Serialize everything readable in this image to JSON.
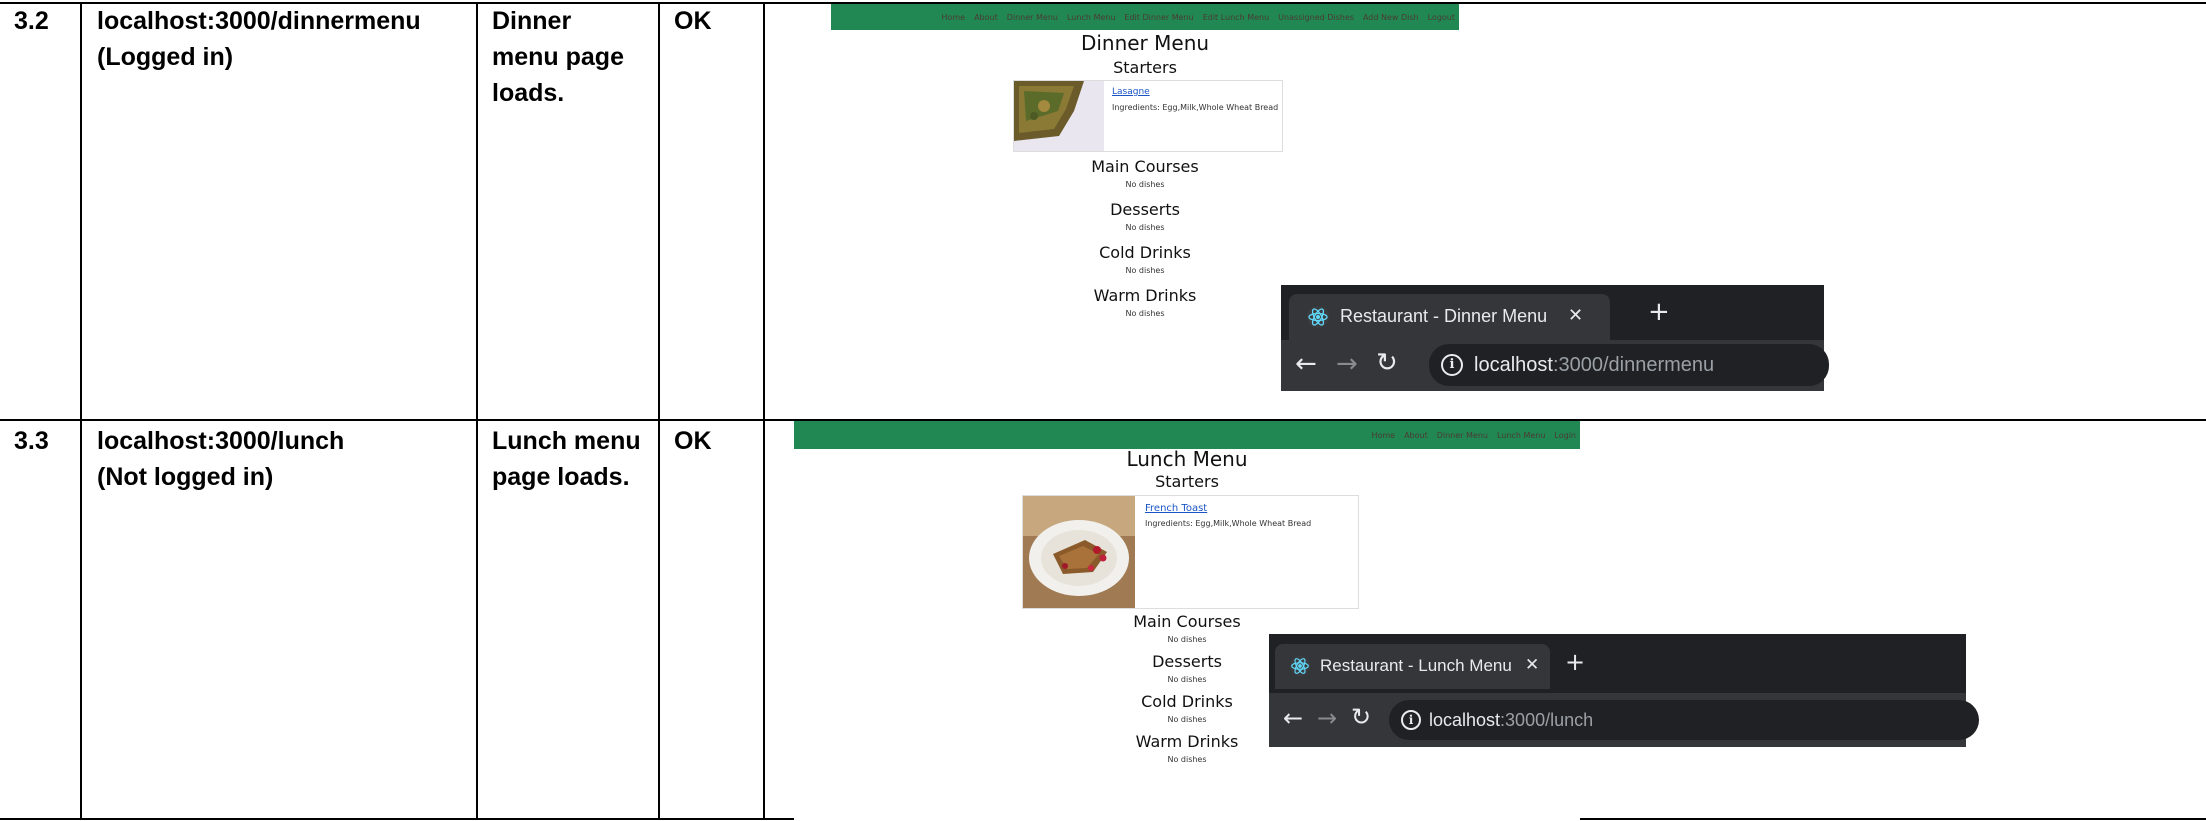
{
  "rows": [
    {
      "id": "3.2",
      "url_lines": [
        "localhost:3000/dinnermenu",
        "(Logged in)"
      ],
      "expected_lines": [
        "Dinner",
        "menu page",
        "loads."
      ],
      "result": "OK",
      "shot": {
        "nav_links": [
          "Home",
          "About",
          "Dinner Menu",
          "Lunch Menu",
          "Edit Dinner Menu",
          "Edit Lunch Menu",
          "Unassigned Dishes",
          "Add New Dish",
          "Logout"
        ],
        "title": "Dinner Menu",
        "starters": "Starters",
        "dish_name": "Lasagne",
        "dish_ingredients": "Ingredients: Egg,Milk,Whole Wheat Bread",
        "sections": [
          "Main Courses",
          "Desserts",
          "Cold Drinks",
          "Warm Drinks"
        ],
        "no_dishes": "No dishes"
      },
      "browser": {
        "tab_title": "Restaurant - Dinner Menu",
        "url_host": "localhost",
        "url_path": ":3000/dinnermenu"
      }
    },
    {
      "id": "3.3",
      "url_lines": [
        "localhost:3000/lunch",
        "(Not logged in)"
      ],
      "expected_lines": [
        "Lunch menu",
        "page loads."
      ],
      "result": "OK",
      "shot": {
        "nav_links": [
          "Home",
          "About",
          "Dinner Menu",
          "Lunch Menu",
          "Login"
        ],
        "title": "Lunch Menu",
        "starters": "Starters",
        "dish_name": "French Toast",
        "dish_ingredients": "Ingredients: Egg,Milk,Whole Wheat Bread",
        "sections": [
          "Main Courses",
          "Desserts",
          "Cold Drinks",
          "Warm Drinks"
        ],
        "no_dishes": "No dishes"
      },
      "browser": {
        "tab_title": "Restaurant - Lunch Menu",
        "url_host": "localhost",
        "url_path": ":3000/lunch"
      }
    }
  ],
  "icons": {
    "close": "✕",
    "new_tab": "+",
    "back": "←",
    "forward": "→",
    "reload": "↻",
    "info": "i"
  }
}
